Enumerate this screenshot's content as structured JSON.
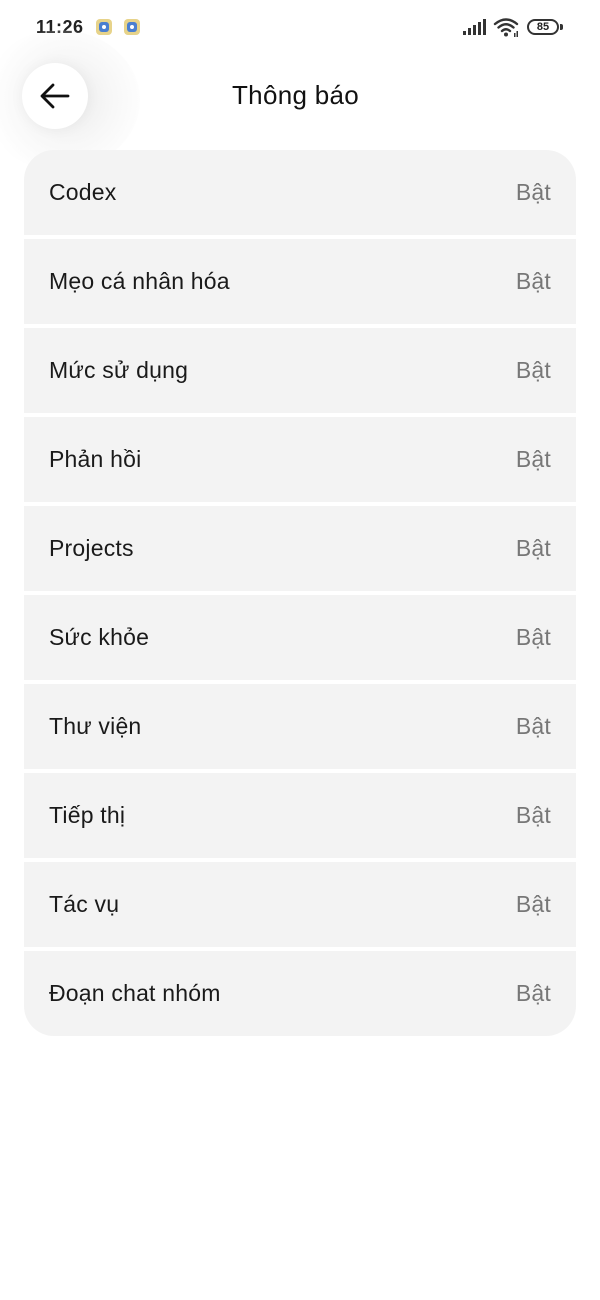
{
  "status_bar": {
    "time": "11:26",
    "battery": "85",
    "notification_icons": [
      "app-notification-icon",
      "app-notification-icon"
    ],
    "signal_icon": "cellular-signal-icon",
    "wifi_icon": "wifi-icon"
  },
  "header": {
    "back_icon": "arrow-left-icon",
    "title": "Thông báo"
  },
  "settings": {
    "items": [
      {
        "label": "Codex",
        "value": "Bật"
      },
      {
        "label": "Mẹo cá nhân hóa",
        "value": "Bật"
      },
      {
        "label": "Mức sử dụng",
        "value": "Bật"
      },
      {
        "label": "Phản hồi",
        "value": "Bật"
      },
      {
        "label": "Projects",
        "value": "Bật"
      },
      {
        "label": "Sức khỏe",
        "value": "Bật"
      },
      {
        "label": "Thư viện",
        "value": "Bật"
      },
      {
        "label": "Tiếp thị",
        "value": "Bật"
      },
      {
        "label": "Tác vụ",
        "value": "Bật"
      },
      {
        "label": "Đoạn chat nhóm",
        "value": "Bật"
      }
    ]
  },
  "colors": {
    "background": "#ffffff",
    "row_background": "#f3f3f3",
    "label": "#1a1a1a",
    "value": "#777777"
  }
}
